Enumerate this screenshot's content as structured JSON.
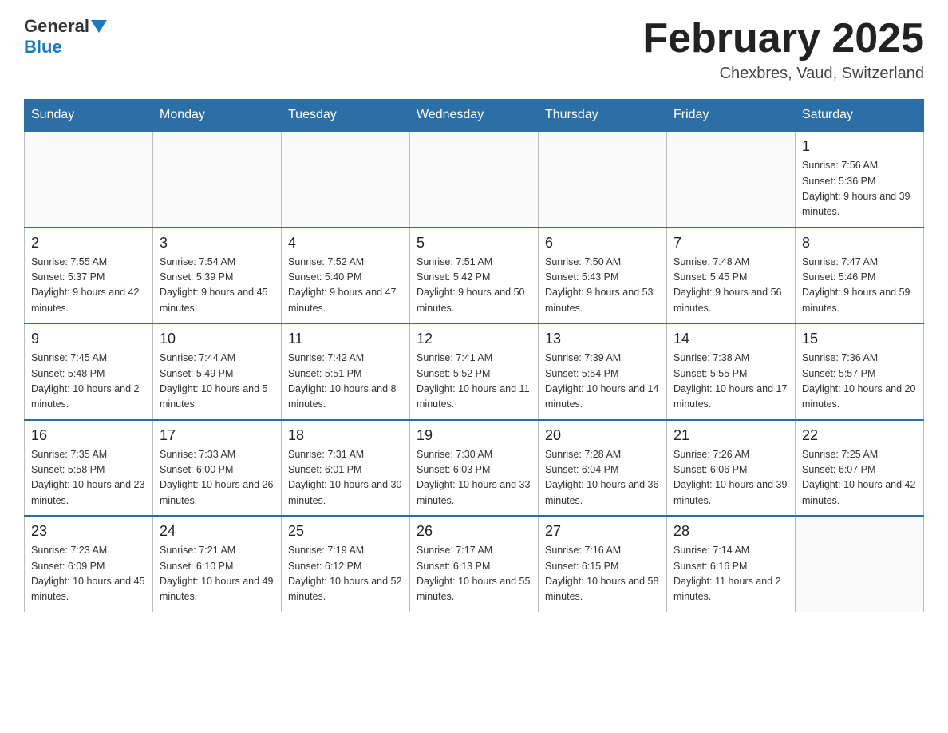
{
  "header": {
    "logo": {
      "general": "General",
      "blue": "Blue"
    },
    "title": "February 2025",
    "location": "Chexbres, Vaud, Switzerland"
  },
  "weekdays": [
    "Sunday",
    "Monday",
    "Tuesday",
    "Wednesday",
    "Thursday",
    "Friday",
    "Saturday"
  ],
  "weeks": [
    [
      {
        "day": "",
        "info": ""
      },
      {
        "day": "",
        "info": ""
      },
      {
        "day": "",
        "info": ""
      },
      {
        "day": "",
        "info": ""
      },
      {
        "day": "",
        "info": ""
      },
      {
        "day": "",
        "info": ""
      },
      {
        "day": "1",
        "info": "Sunrise: 7:56 AM\nSunset: 5:36 PM\nDaylight: 9 hours and 39 minutes."
      }
    ],
    [
      {
        "day": "2",
        "info": "Sunrise: 7:55 AM\nSunset: 5:37 PM\nDaylight: 9 hours and 42 minutes."
      },
      {
        "day": "3",
        "info": "Sunrise: 7:54 AM\nSunset: 5:39 PM\nDaylight: 9 hours and 45 minutes."
      },
      {
        "day": "4",
        "info": "Sunrise: 7:52 AM\nSunset: 5:40 PM\nDaylight: 9 hours and 47 minutes."
      },
      {
        "day": "5",
        "info": "Sunrise: 7:51 AM\nSunset: 5:42 PM\nDaylight: 9 hours and 50 minutes."
      },
      {
        "day": "6",
        "info": "Sunrise: 7:50 AM\nSunset: 5:43 PM\nDaylight: 9 hours and 53 minutes."
      },
      {
        "day": "7",
        "info": "Sunrise: 7:48 AM\nSunset: 5:45 PM\nDaylight: 9 hours and 56 minutes."
      },
      {
        "day": "8",
        "info": "Sunrise: 7:47 AM\nSunset: 5:46 PM\nDaylight: 9 hours and 59 minutes."
      }
    ],
    [
      {
        "day": "9",
        "info": "Sunrise: 7:45 AM\nSunset: 5:48 PM\nDaylight: 10 hours and 2 minutes."
      },
      {
        "day": "10",
        "info": "Sunrise: 7:44 AM\nSunset: 5:49 PM\nDaylight: 10 hours and 5 minutes."
      },
      {
        "day": "11",
        "info": "Sunrise: 7:42 AM\nSunset: 5:51 PM\nDaylight: 10 hours and 8 minutes."
      },
      {
        "day": "12",
        "info": "Sunrise: 7:41 AM\nSunset: 5:52 PM\nDaylight: 10 hours and 11 minutes."
      },
      {
        "day": "13",
        "info": "Sunrise: 7:39 AM\nSunset: 5:54 PM\nDaylight: 10 hours and 14 minutes."
      },
      {
        "day": "14",
        "info": "Sunrise: 7:38 AM\nSunset: 5:55 PM\nDaylight: 10 hours and 17 minutes."
      },
      {
        "day": "15",
        "info": "Sunrise: 7:36 AM\nSunset: 5:57 PM\nDaylight: 10 hours and 20 minutes."
      }
    ],
    [
      {
        "day": "16",
        "info": "Sunrise: 7:35 AM\nSunset: 5:58 PM\nDaylight: 10 hours and 23 minutes."
      },
      {
        "day": "17",
        "info": "Sunrise: 7:33 AM\nSunset: 6:00 PM\nDaylight: 10 hours and 26 minutes."
      },
      {
        "day": "18",
        "info": "Sunrise: 7:31 AM\nSunset: 6:01 PM\nDaylight: 10 hours and 30 minutes."
      },
      {
        "day": "19",
        "info": "Sunrise: 7:30 AM\nSunset: 6:03 PM\nDaylight: 10 hours and 33 minutes."
      },
      {
        "day": "20",
        "info": "Sunrise: 7:28 AM\nSunset: 6:04 PM\nDaylight: 10 hours and 36 minutes."
      },
      {
        "day": "21",
        "info": "Sunrise: 7:26 AM\nSunset: 6:06 PM\nDaylight: 10 hours and 39 minutes."
      },
      {
        "day": "22",
        "info": "Sunrise: 7:25 AM\nSunset: 6:07 PM\nDaylight: 10 hours and 42 minutes."
      }
    ],
    [
      {
        "day": "23",
        "info": "Sunrise: 7:23 AM\nSunset: 6:09 PM\nDaylight: 10 hours and 45 minutes."
      },
      {
        "day": "24",
        "info": "Sunrise: 7:21 AM\nSunset: 6:10 PM\nDaylight: 10 hours and 49 minutes."
      },
      {
        "day": "25",
        "info": "Sunrise: 7:19 AM\nSunset: 6:12 PM\nDaylight: 10 hours and 52 minutes."
      },
      {
        "day": "26",
        "info": "Sunrise: 7:17 AM\nSunset: 6:13 PM\nDaylight: 10 hours and 55 minutes."
      },
      {
        "day": "27",
        "info": "Sunrise: 7:16 AM\nSunset: 6:15 PM\nDaylight: 10 hours and 58 minutes."
      },
      {
        "day": "28",
        "info": "Sunrise: 7:14 AM\nSunset: 6:16 PM\nDaylight: 11 hours and 2 minutes."
      },
      {
        "day": "",
        "info": ""
      }
    ]
  ]
}
